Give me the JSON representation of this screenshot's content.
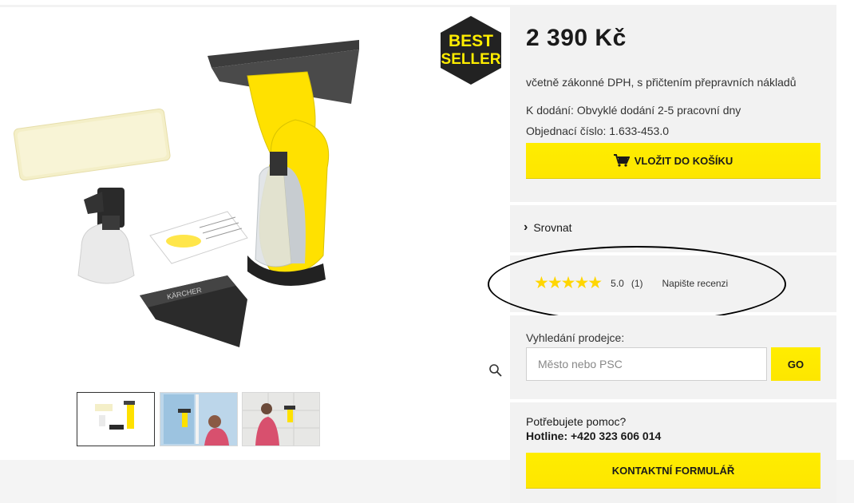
{
  "product": {
    "price": "2 390 Kč",
    "vat_note": "včetně zákonné DPH, s přičtením přepravních nákladů",
    "delivery": "K dodání: Obvyklé dodání 2-5 pracovní dny",
    "order_number": "Objednací číslo: 1.633-453.0",
    "add_to_cart": "VLOŽIT DO KOŠÍKU",
    "badge_line1": "BEST",
    "badge_line2": "SELLER",
    "box_label": "KÄRCHER"
  },
  "compare": {
    "label": "Srovnat"
  },
  "rating": {
    "stars": "★★★★★",
    "value": "5.0",
    "count": "(1)",
    "write_review": "Napište recenzi"
  },
  "dealer": {
    "label": "Vyhledání prodejce:",
    "placeholder": "Město nebo PSC",
    "go": "GO"
  },
  "help": {
    "question": "Potřebujete pomoc?",
    "hotline": "Hotline: +420 323 606 014",
    "contact_button": "KONTAKTNÍ FORMULÁŘ"
  },
  "thumbnails": [
    {
      "name": "product-set",
      "active": true
    },
    {
      "name": "window-cleaning"
    },
    {
      "name": "tile-cleaning"
    }
  ],
  "colors": {
    "accent": "#ffed00",
    "panel": "#f2f2f2",
    "text": "#1a1a1a"
  }
}
